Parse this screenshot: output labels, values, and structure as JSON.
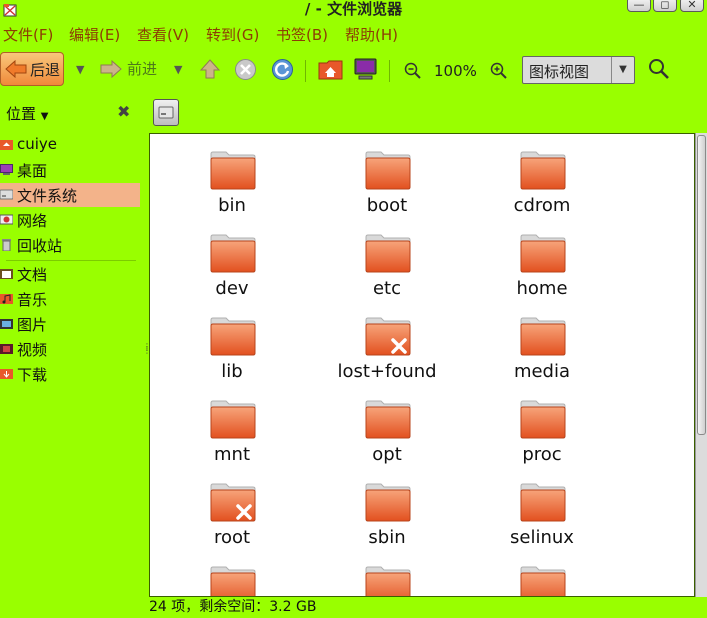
{
  "window": {
    "title": "/ - 文件浏览器"
  },
  "menu": [
    "文件(F)",
    "编辑(E)",
    "查看(V)",
    "转到(G)",
    "书签(B)",
    "帮助(H)"
  ],
  "toolbar": {
    "back_label": "后退",
    "forward_label": "前进",
    "zoom_level": "100%",
    "view_mode": "图标视图"
  },
  "sidebar": {
    "header": "位置",
    "places": [
      {
        "label": "cuiye",
        "icon": "home-folder-icon"
      },
      {
        "label": "桌面",
        "icon": "desktop-icon"
      },
      {
        "label": "文件系统",
        "icon": "filesystem-drive-icon",
        "selected": true
      },
      {
        "label": "网络",
        "icon": "network-icon"
      },
      {
        "label": "回收站",
        "icon": "trash-icon"
      }
    ],
    "bookmarks": [
      {
        "label": "文档",
        "icon": "documents-icon"
      },
      {
        "label": "音乐",
        "icon": "music-icon"
      },
      {
        "label": "图片",
        "icon": "pictures-icon"
      },
      {
        "label": "视频",
        "icon": "videos-icon"
      },
      {
        "label": "下载",
        "icon": "downloads-icon"
      }
    ]
  },
  "files": [
    {
      "name": "bin",
      "locked": false
    },
    {
      "name": "boot",
      "locked": false
    },
    {
      "name": "cdrom",
      "locked": false
    },
    {
      "name": "dev",
      "locked": false
    },
    {
      "name": "etc",
      "locked": false
    },
    {
      "name": "home",
      "locked": false
    },
    {
      "name": "lib",
      "locked": false
    },
    {
      "name": "lost+found",
      "locked": true
    },
    {
      "name": "media",
      "locked": false
    },
    {
      "name": "mnt",
      "locked": false
    },
    {
      "name": "opt",
      "locked": false
    },
    {
      "name": "proc",
      "locked": false
    },
    {
      "name": "root",
      "locked": true
    },
    {
      "name": "sbin",
      "locked": false
    },
    {
      "name": "selinux",
      "locked": false
    },
    {
      "name": "",
      "locked": false
    },
    {
      "name": "",
      "locked": false
    },
    {
      "name": "",
      "locked": false
    }
  ],
  "status": {
    "text": "24 项，剩余空间：3.2 GB"
  },
  "colors": {
    "background": "#99ff00",
    "folder": "#e8582a",
    "selected": "#f3b38a",
    "menu_text": "#8c3d04"
  }
}
